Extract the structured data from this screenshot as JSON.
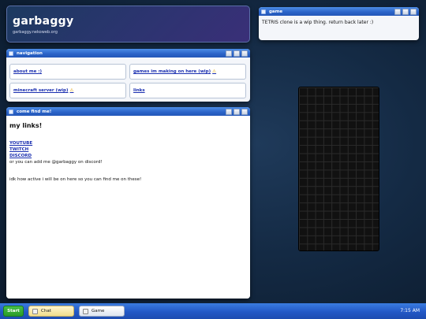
{
  "header": {
    "title": "garbaggy",
    "subtitle": "garbaggy.nekoweb.org"
  },
  "game_window": {
    "title": "game",
    "message": "TETRIS clone is a wip thing. return back later :)"
  },
  "nav_window": {
    "title": "navigation",
    "items": [
      {
        "label": "about me :)",
        "warn": ""
      },
      {
        "label": "games im making on here (wip)",
        "warn": "⚠"
      },
      {
        "label": "minecraft server (wip)",
        "warn": "⚠"
      },
      {
        "label": "links",
        "warn": ""
      }
    ]
  },
  "find_window": {
    "title": "come find me!",
    "heading": "my links!",
    "links": [
      "YOUTUBE",
      "TWITCH",
      "DISCORD"
    ],
    "discord_note": "or you can add me @garbaggy on discord!",
    "activity_note": "idk how active i will be on here so you can find me on these!"
  },
  "taskbar": {
    "start_label": "Start",
    "tasks": [
      {
        "label": "Chat"
      },
      {
        "label": "Game"
      }
    ],
    "clock": "7:15 AM"
  },
  "colors": {
    "accent": "#2a62c7",
    "link": "#1a2fb0",
    "start": "#2a9a2a"
  }
}
